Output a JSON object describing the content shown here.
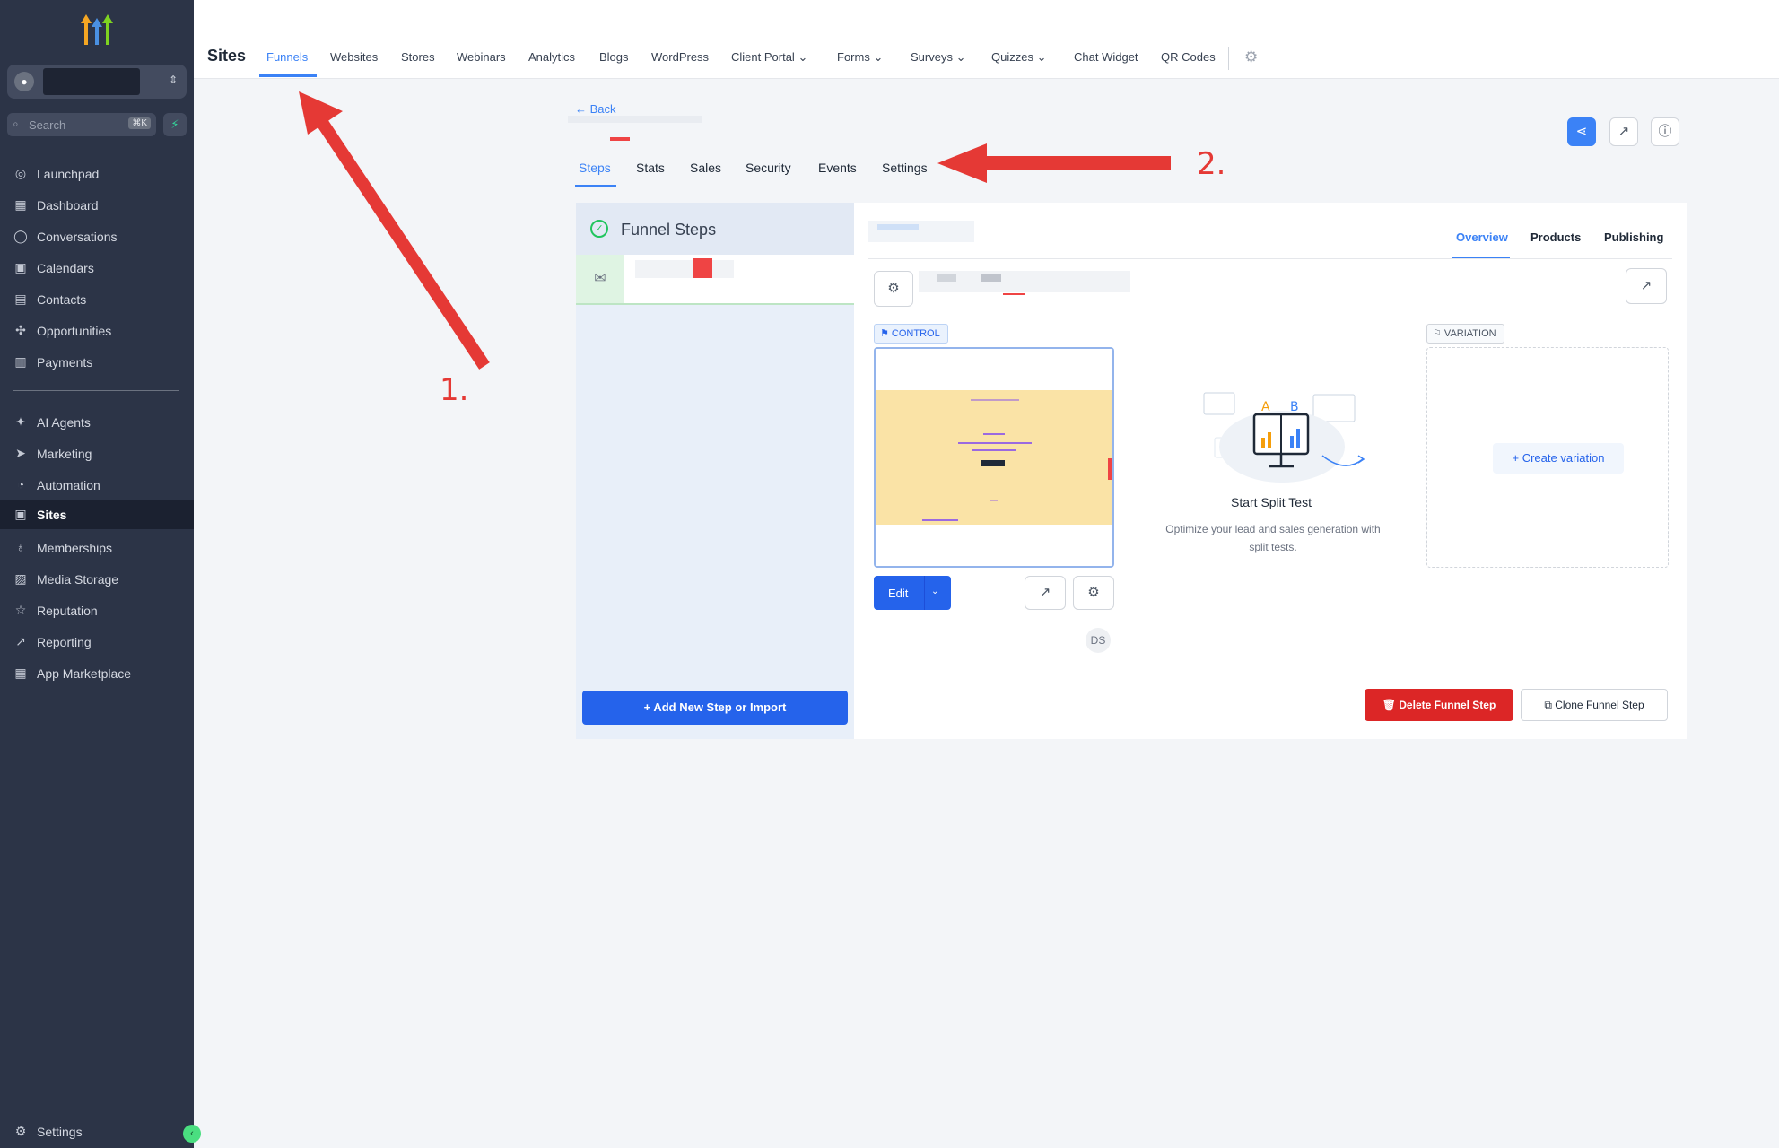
{
  "sidebar": {
    "search_placeholder": "Search",
    "search_shortcut": "⌘K",
    "nav_top": [
      {
        "label": "Launchpad"
      },
      {
        "label": "Dashboard"
      },
      {
        "label": "Conversations"
      },
      {
        "label": "Calendars"
      },
      {
        "label": "Contacts"
      },
      {
        "label": "Opportunities"
      },
      {
        "label": "Payments"
      }
    ],
    "nav_bottom": [
      {
        "label": "AI Agents"
      },
      {
        "label": "Marketing"
      },
      {
        "label": "Automation"
      },
      {
        "label": "Sites"
      },
      {
        "label": "Memberships"
      },
      {
        "label": "Media Storage"
      },
      {
        "label": "Reputation"
      },
      {
        "label": "Reporting"
      },
      {
        "label": "App Marketplace"
      }
    ],
    "active": "Sites",
    "settings_label": "Settings"
  },
  "topbar": {
    "title": "Sites",
    "tabs": [
      {
        "label": "Funnels"
      },
      {
        "label": "Websites"
      },
      {
        "label": "Stores"
      },
      {
        "label": "Webinars"
      },
      {
        "label": "Analytics"
      },
      {
        "label": "Blogs"
      },
      {
        "label": "WordPress"
      },
      {
        "label": "Client Portal"
      },
      {
        "label": "Forms"
      },
      {
        "label": "Surveys"
      },
      {
        "label": "Quizzes"
      },
      {
        "label": "Chat Widget"
      },
      {
        "label": "QR Codes"
      }
    ],
    "active_tab": "Funnels"
  },
  "funnel": {
    "back_label": "← Back",
    "tabs": [
      {
        "label": "Steps"
      },
      {
        "label": "Stats"
      },
      {
        "label": "Sales"
      },
      {
        "label": "Security"
      },
      {
        "label": "Events"
      },
      {
        "label": "Settings"
      }
    ],
    "active_tab": "Steps",
    "steps_title": "Funnel Steps",
    "add_step_label": "+    Add New Step or Import",
    "right_tabs": [
      {
        "label": "Overview"
      },
      {
        "label": "Products"
      },
      {
        "label": "Publishing"
      }
    ],
    "active_right_tab": "Overview",
    "control_label": "CONTROL",
    "variation_label": "VARIATION",
    "edit_label": "Edit",
    "avatar_initials": "DS",
    "split_title": "Start Split Test",
    "split_desc": "Optimize your lead and sales generation with split tests.",
    "create_variation_label": "+   Create variation",
    "delete_label": "Delete Funnel Step",
    "clone_label": "Clone Funnel Step"
  },
  "annotations": {
    "one": "1.",
    "two": "2."
  },
  "colors": {
    "sidebar_bg": "#2c3447",
    "accent": "#3b82f6",
    "danger": "#dc2626",
    "annotation_red": "#e53935"
  }
}
